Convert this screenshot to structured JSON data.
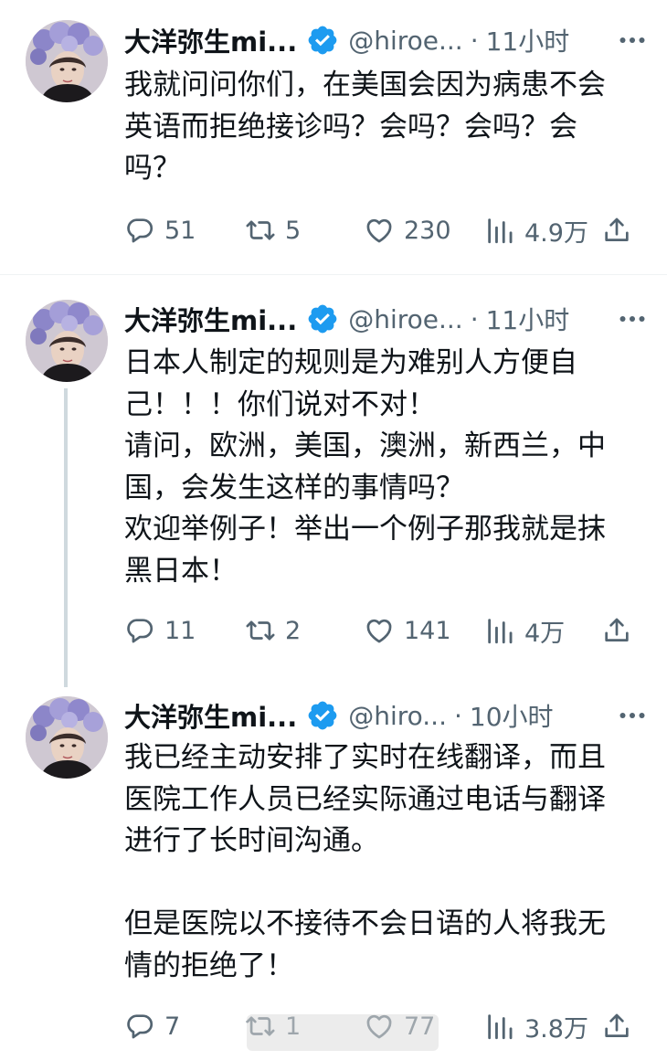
{
  "tweets": [
    {
      "name": "大洋弥生mi...",
      "handle": "@hiroe...",
      "time": "11小时",
      "text": "我就问问你们，在美国会因为病患不会\n英语而拒绝接诊吗？会吗？会吗？会\n吗？",
      "replies": "51",
      "retweets": "5",
      "likes": "230",
      "views": "4.9万"
    },
    {
      "name": "大洋弥生mi...",
      "handle": "@hiroe...",
      "time": "11小时",
      "text": "日本人制定的规则是为难别人方便自\n己！！！你们说对不对！\n请问，欧洲，美国，澳洲，新西兰，中\n国，会发生这样的事情吗？\n欢迎举例子！举出一个例子那我就是抹\n黑日本！",
      "replies": "11",
      "retweets": "2",
      "likes": "141",
      "views": "4万"
    },
    {
      "name": "大洋弥生mi...",
      "handle": "@hiro...",
      "time": "10小时",
      "text": "我已经主动安排了实时在线翻译，而且\n医院工作人员已经实际通过电话与翻译\n进行了长时间沟通。\n\n但是医院以不接待不会日语的人将我无\n情的拒绝了！",
      "replies": "7",
      "retweets": "1",
      "likes": "77",
      "views": "3.8万"
    }
  ],
  "colors": {
    "text": "#0f1419",
    "secondary": "#536471",
    "verified": "#1d9bf0",
    "thread_line": "#cfd9de"
  },
  "icons": [
    "verified-badge-icon",
    "more-icon",
    "reply-icon",
    "retweet-icon",
    "like-icon",
    "views-icon",
    "share-icon"
  ]
}
